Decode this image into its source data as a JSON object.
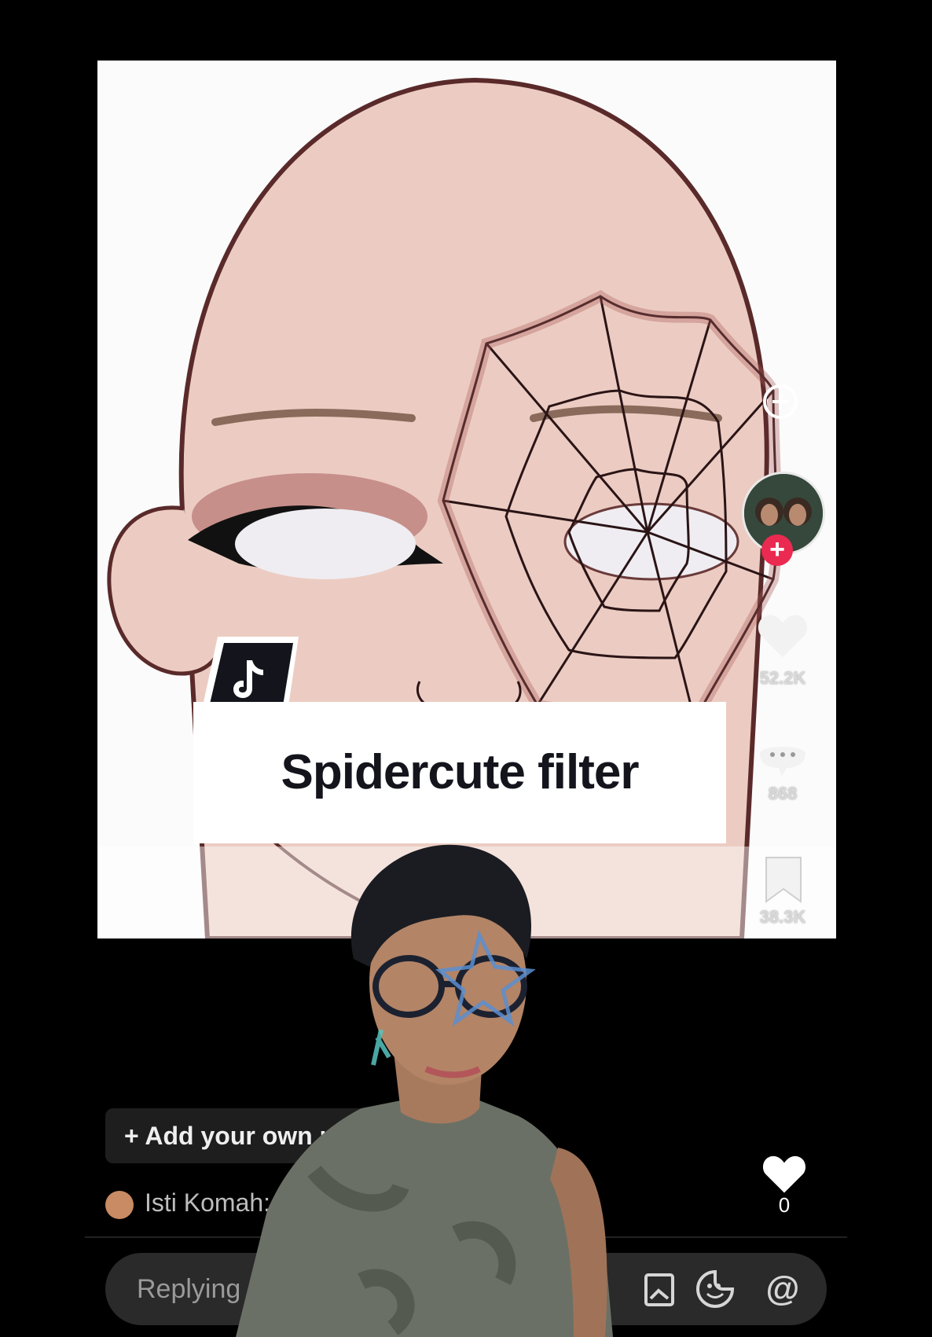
{
  "video": {
    "stats": {
      "likes": "52.2K",
      "comments": "868",
      "saves": "38.3K"
    },
    "logo_icon": "tiktok-note-icon"
  },
  "banner": {
    "title": "Spidercute filter"
  },
  "comments": {
    "add_photo_label": "+ Add your own photo",
    "comment_text": "Isti Komah: ba",
    "like_count": "0"
  },
  "reply": {
    "placeholder": "Replying"
  },
  "colors": {
    "skin": "#eccdc4",
    "web": "#3a1518",
    "follow": "#ea2a50",
    "banner_text": "#14151c"
  }
}
